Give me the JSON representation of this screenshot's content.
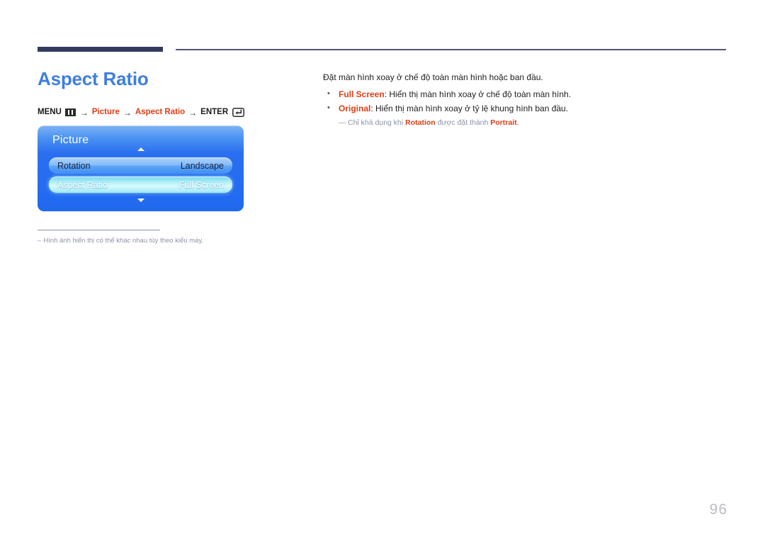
{
  "header": {
    "rule_thick_color": "#343a5e",
    "rule_thin_color": "#4f5573"
  },
  "page_title": "Aspect Ratio",
  "title_color": "#3d7fe0",
  "breadcrumb": {
    "menu_label": "MENU",
    "menu_icon": "menu-bars-icon",
    "arrow": "→",
    "step1": "Picture",
    "step2": "Aspect Ratio",
    "enter_label": "ENTER",
    "enter_icon": "enter-return-icon",
    "accent_color": "#e03c13"
  },
  "osd": {
    "title": "Picture",
    "caret_up_icon": "chevron-up-icon",
    "caret_down_icon": "chevron-down-icon",
    "rows": [
      {
        "label": "Rotation",
        "value": "Landscape",
        "selected": false
      },
      {
        "label": "Aspect Ratio",
        "value": "Full Screen",
        "selected": true
      }
    ]
  },
  "footnote": {
    "dash": "–",
    "text": "Hình ảnh hiển thị có thể khác nhau tùy theo kiểu máy."
  },
  "content": {
    "lead": "Đặt màn hình xoay ở chế độ toàn màn hình hoặc ban đầu.",
    "bullets": [
      {
        "dot": "•",
        "term": "Full Screen",
        "rest": ": Hiển thị màn hình xoay ở chế độ toàn màn hình."
      },
      {
        "dot": "•",
        "term": "Original",
        "rest": ": Hiển thị màn hình xoay ở tỷ lệ khung hình ban đầu."
      }
    ],
    "subnote": {
      "dash": "—",
      "pre": "Chỉ khả dụng khi ",
      "term1": "Rotation",
      "mid": " được đặt thành ",
      "term2": "Portrait",
      "post": "."
    }
  },
  "page_number": "96"
}
